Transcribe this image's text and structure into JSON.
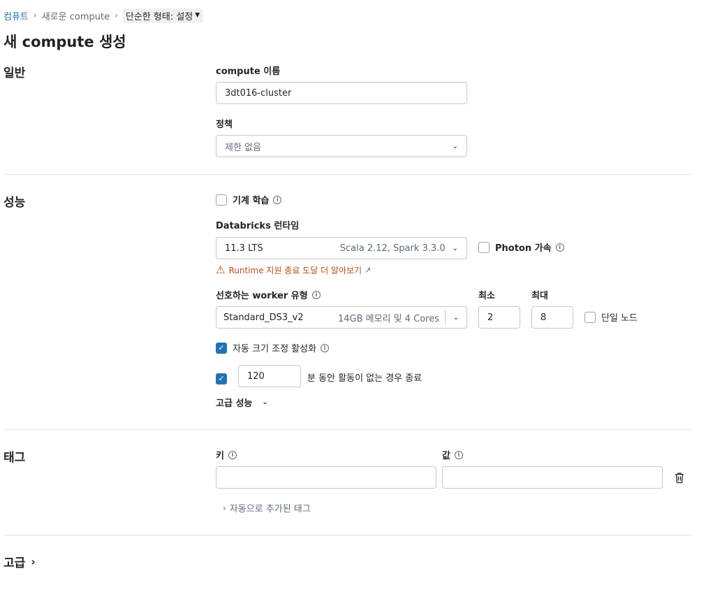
{
  "breadcrumb": {
    "root": "컴퓨트",
    "middle": "새로운 compute",
    "current": "단순한 형태: 설정"
  },
  "page_title": "새 compute 생성",
  "general": {
    "section_title": "일반",
    "name_label": "compute 이름",
    "name_value": "3dt016-cluster",
    "policy_label": "정책",
    "policy_value": "제한 없음"
  },
  "performance": {
    "section_title": "성능",
    "ml_label": "기계 학습",
    "runtime_label": "Databricks 런타임",
    "runtime_value": "11.3 LTS",
    "runtime_detail": "Scala 2.12, Spark 3.3.0",
    "photon_label": "Photon 가속",
    "runtime_warning": "Runtime 지원 종료 도달 더 알아보기",
    "worker_label": "선호하는 worker 유형",
    "worker_value": "Standard_DS3_v2",
    "worker_detail": "14GB 메모리 및 4 Cores",
    "min_label": "최소",
    "min_value": "2",
    "max_label": "최대",
    "max_value": "8",
    "single_node_label": "단일 노드",
    "autoscale_label": "자동 크기 조정 활성화",
    "autoscale_checked": true,
    "terminate_checked": true,
    "terminate_minutes": "120",
    "terminate_label": "분 동안 활동이 없는 경우 종료",
    "advanced_perf_label": "고급 성능"
  },
  "tags": {
    "section_title": "태그",
    "key_label": "키",
    "value_label": "값",
    "auto_tags_label": "자동으로 추가된 태그"
  },
  "advanced": {
    "section_title": "고급"
  },
  "colors": {
    "accent": "#2272b4",
    "warning": "#b34f23",
    "border": "#c3c9cf"
  }
}
